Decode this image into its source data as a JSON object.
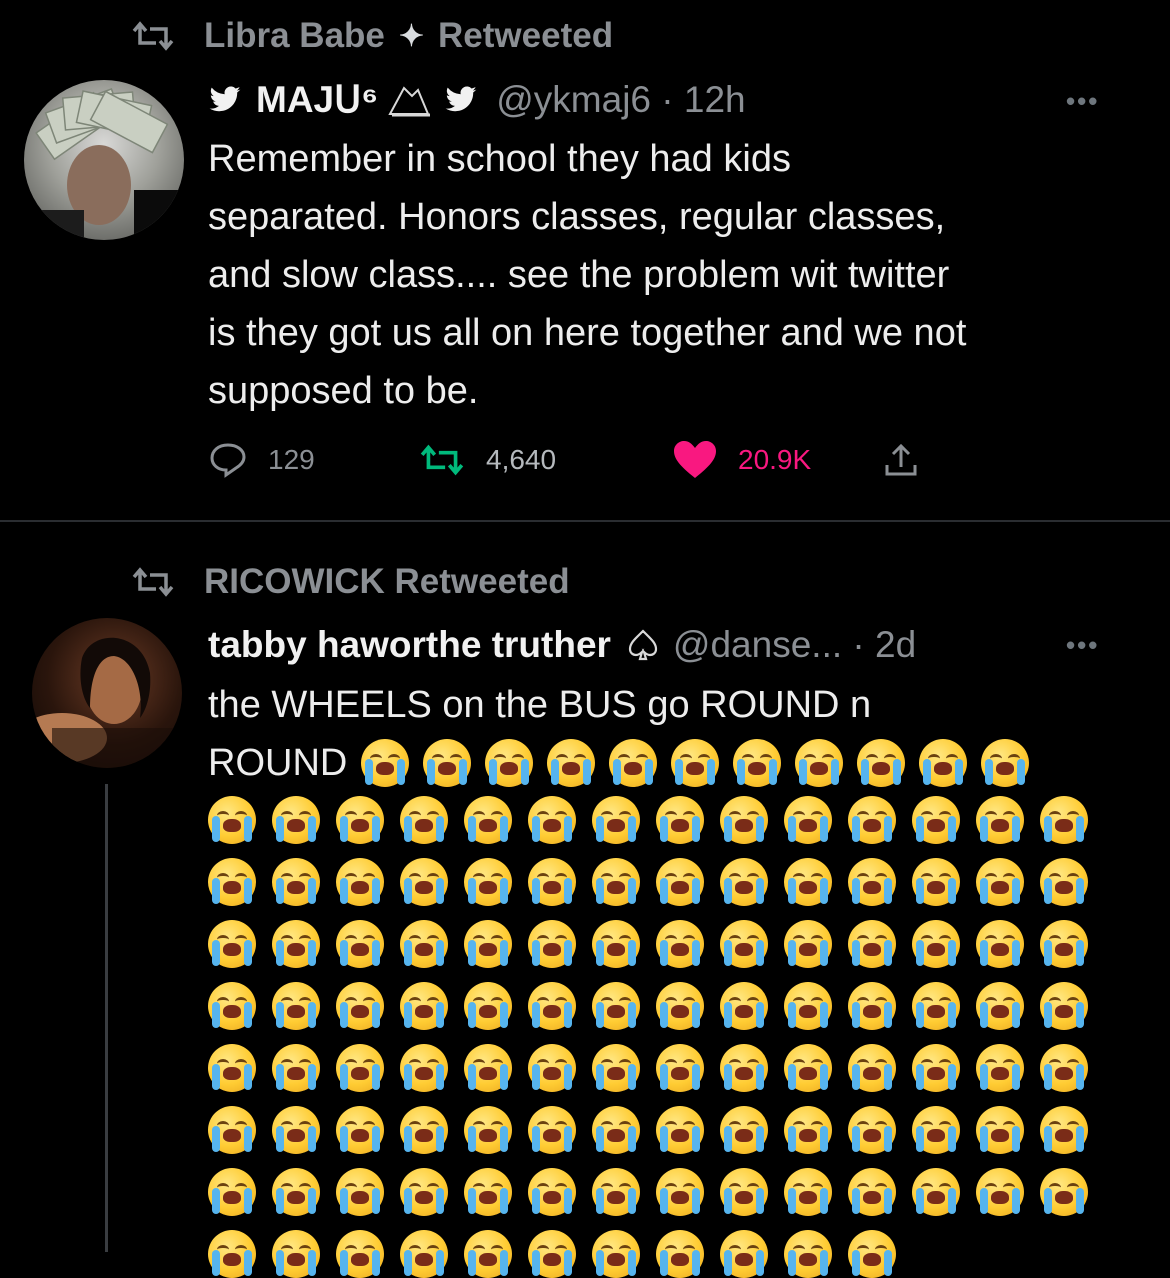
{
  "tweet1": {
    "retweeted_by": "Libra Babe",
    "retweeted_suffix": "Retweeted",
    "sparkles": "✨",
    "author_name": "MAJᑌ⁶",
    "author_handle": "@ykmaj6 · 12h",
    "more": "•••",
    "text_lines": [
      "Remember in school they had kids",
      "separated. Honors classes, regular classes,",
      "and slow class.... see the problem wit twitter",
      "is they got us all on here together and we not",
      "supposed to be."
    ],
    "replies": "129",
    "retweets": "4,640",
    "likes": "20.9K",
    "icons": {
      "reply": "reply-icon",
      "retweet": "retweet-icon",
      "like": "heart-icon",
      "share": "share-icon"
    },
    "colors": {
      "retweet_active": "#00ba7c",
      "like_active": "#f91880",
      "muted": "#8b8f94"
    }
  },
  "tweet2": {
    "retweeted_by": "RICOWICK Retweeted",
    "author_name": "tabby haworthe truther",
    "author_handle": "@danse... · 2d",
    "more": "•••",
    "text_line1": "the WHEELS on the BUS go ROUND n",
    "text_line2": "ROUND",
    "emoji": "loudly-crying-face",
    "inline_emoji_count": 11,
    "grid_emoji_rows": 8,
    "grid_emoji_cols": 14,
    "last_row_count": 11
  }
}
